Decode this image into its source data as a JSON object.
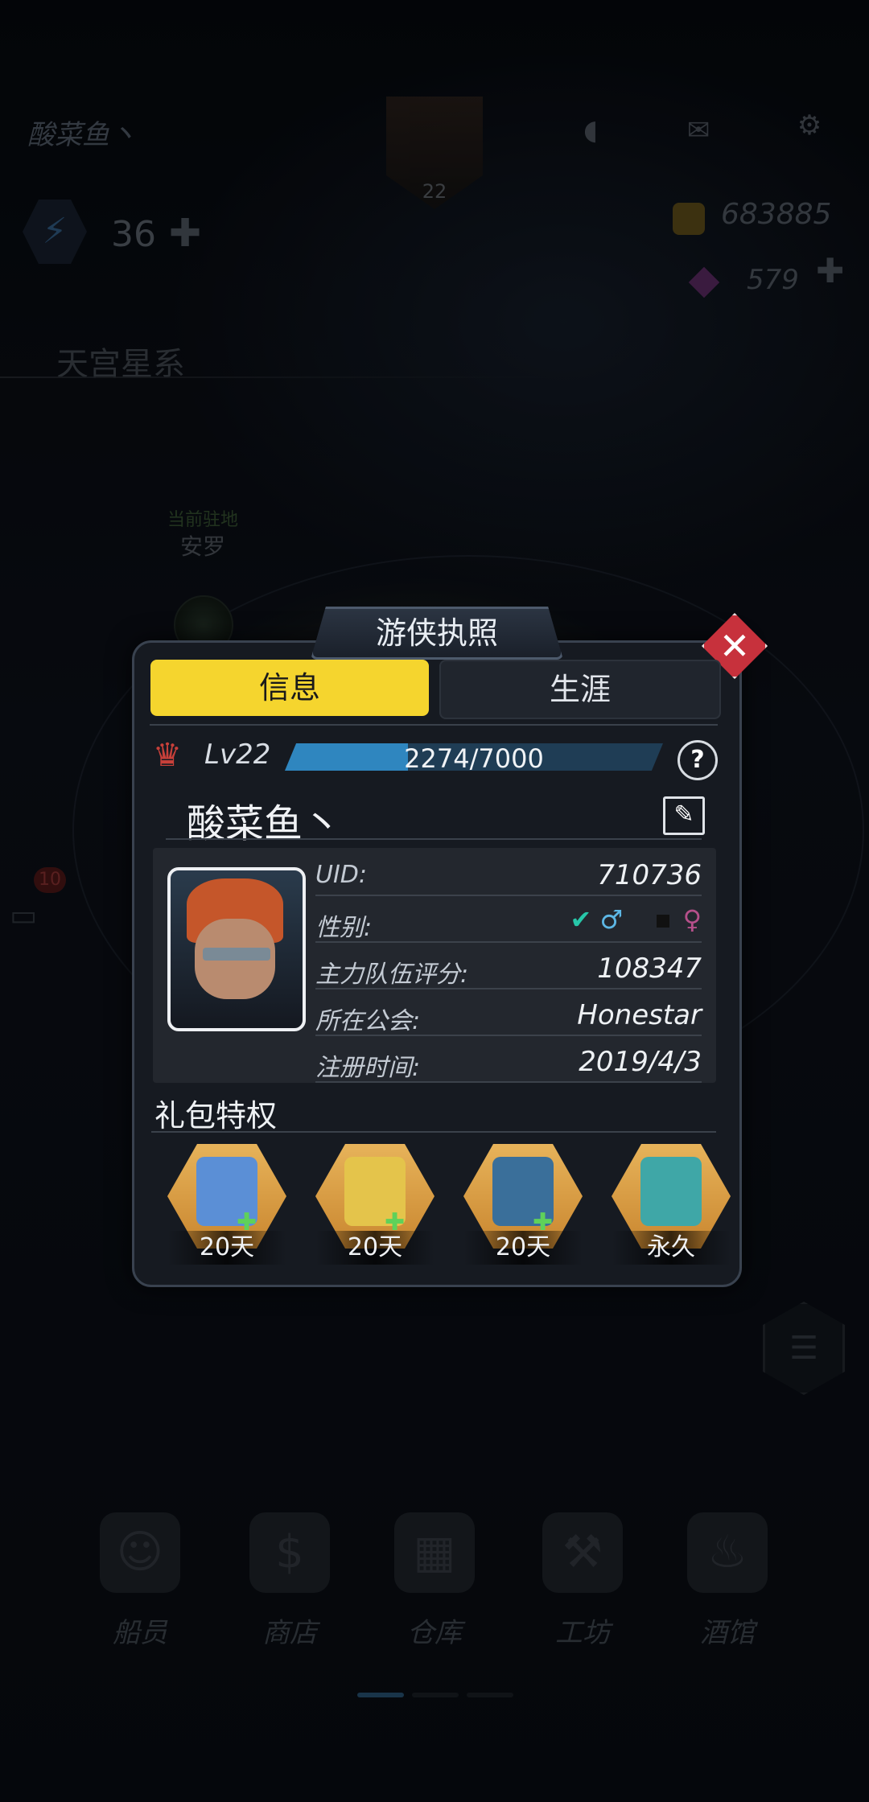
{
  "background": {
    "player_name": "酸菜鱼丶",
    "portrait_level": "22",
    "energy": "36",
    "gold": "683885",
    "gems": "579",
    "galaxy": "天宫星系",
    "station_label": "当前驻地",
    "station_name": "安罗",
    "chat_badge": "10",
    "nav": [
      {
        "label": "船员"
      },
      {
        "label": "商店"
      },
      {
        "label": "仓库"
      },
      {
        "label": "工坊"
      },
      {
        "label": "酒馆"
      }
    ]
  },
  "modal": {
    "title": "游侠执照",
    "close_glyph": "✕",
    "tabs": {
      "info": "信息",
      "career": "生涯"
    },
    "level_text": "Lv22",
    "xp": {
      "current": 2274,
      "max": 7000,
      "text": "2274/7000"
    },
    "help_glyph": "?",
    "name": "酸菜鱼丶",
    "rows": {
      "uid": {
        "label": "UID:",
        "value": "710736"
      },
      "gender": {
        "label": "性别:",
        "male": "♂",
        "female": "♀",
        "selected": "male"
      },
      "score": {
        "label": "主力队伍评分:",
        "value": "108347"
      },
      "guild": {
        "label": "所在公会:",
        "value": "Honestar"
      },
      "registered": {
        "label": "注册时间:",
        "value": "2019/4/3"
      }
    },
    "perks_title": "礼包特权",
    "perks": [
      {
        "duration": "20天",
        "color": "#5b8fd6"
      },
      {
        "duration": "20天",
        "color": "#e4c44b"
      },
      {
        "duration": "20天",
        "color": "#3a6f9a"
      },
      {
        "duration": "永久",
        "color": "#3fa7a7"
      }
    ]
  }
}
